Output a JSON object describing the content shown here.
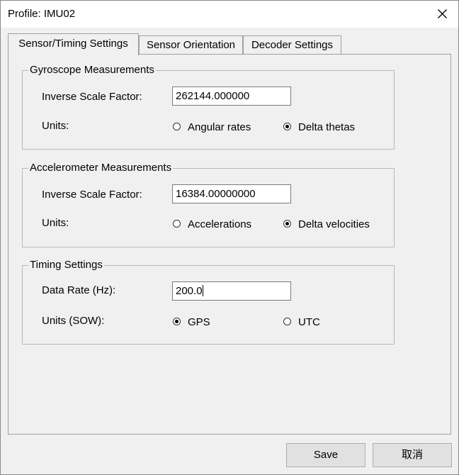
{
  "window": {
    "title": "Profile: IMU02",
    "close_symbol": "×"
  },
  "tabs": [
    {
      "label": "Sensor/Timing Settings",
      "active": true
    },
    {
      "label": "Sensor Orientation",
      "active": false
    },
    {
      "label": "Decoder Settings",
      "active": false
    }
  ],
  "gyro": {
    "title": "Gyroscope Measurements",
    "scale_label": "Inverse Scale Factor:",
    "scale_value": "262144.000000",
    "units_label": "Units:",
    "option1": "Angular rates",
    "option2": "Delta thetas",
    "selected": "Delta thetas"
  },
  "accel": {
    "title": "Accelerometer Measurements",
    "scale_label": "Inverse Scale Factor:",
    "scale_value": "16384.00000000",
    "units_label": "Units:",
    "option1": "Accelerations",
    "option2": "Delta velocities",
    "selected": "Delta velocities"
  },
  "timing": {
    "title": "Timing Settings",
    "rate_label": "Data Rate (Hz):",
    "rate_value": "200.0",
    "units_label": "Units (SOW):",
    "option1": "GPS",
    "option2": "UTC",
    "selected": "GPS"
  },
  "buttons": {
    "save": "Save",
    "cancel": "取消"
  }
}
